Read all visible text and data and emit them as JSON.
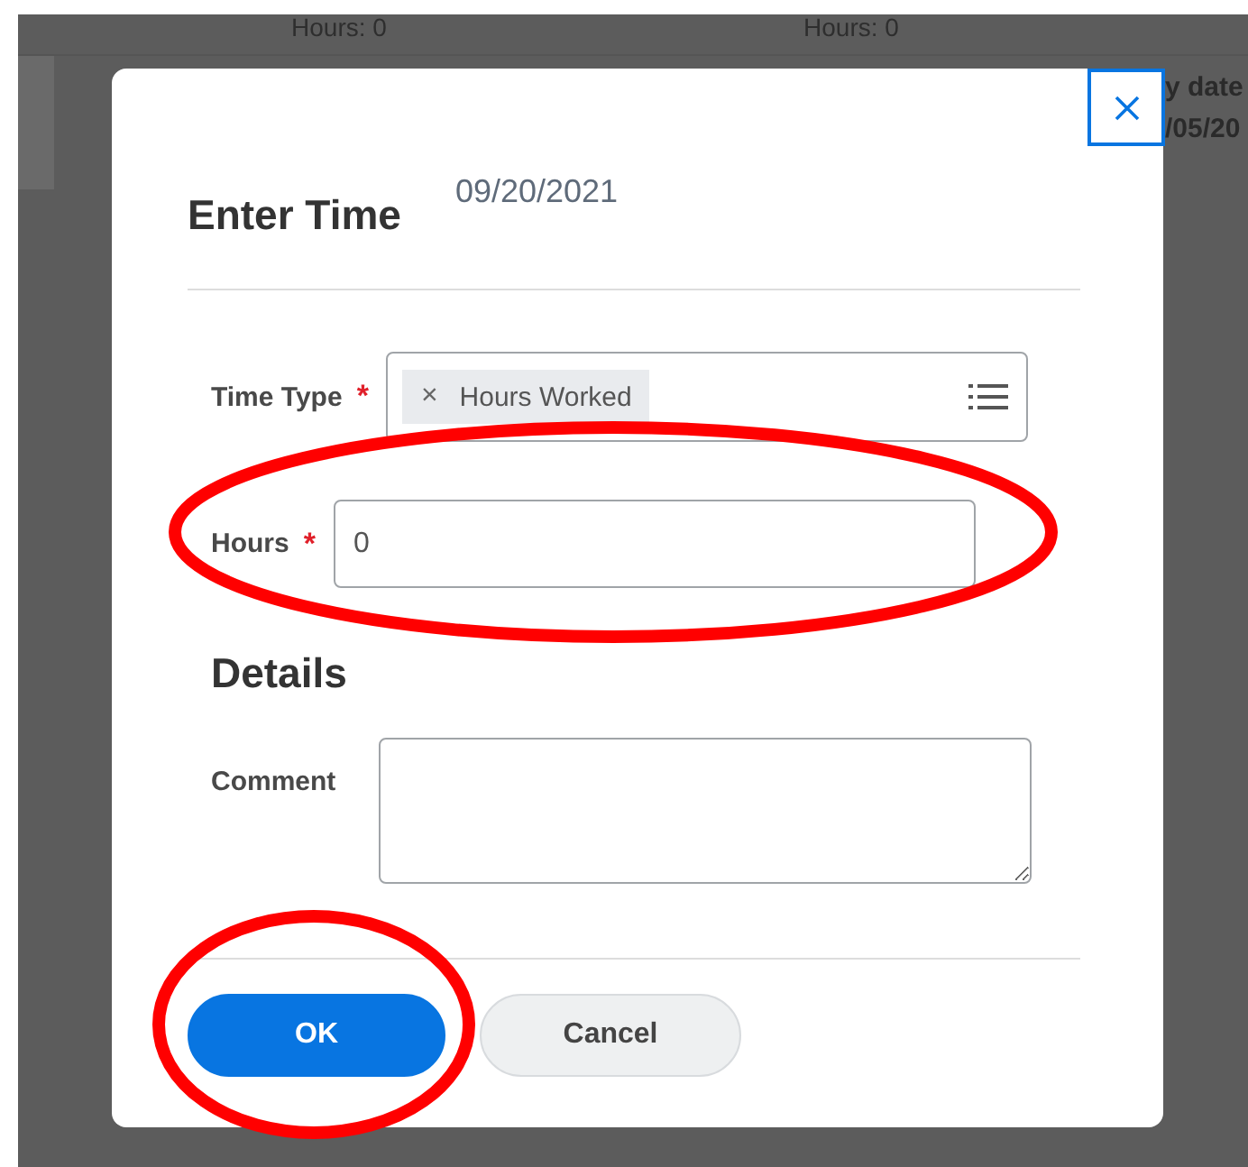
{
  "background": {
    "column_totals": [
      "Hours: 0",
      "Hours: 0"
    ],
    "side_text": [
      "y date",
      "/05/20"
    ]
  },
  "dialog": {
    "title": "Enter Time",
    "date": "09/20/2021",
    "fields": [
      {
        "kind": "multiselect",
        "label": "Time Type",
        "required_mark": "*",
        "tokens": [
          {
            "remove": "×",
            "text": "Hours Worked"
          }
        ]
      },
      {
        "kind": "text",
        "label": "Hours",
        "required_mark": "*",
        "value": "0"
      }
    ],
    "section": "Details",
    "comment": {
      "label": "Comment"
    },
    "buttons": [
      {
        "label": "OK",
        "primary": true
      },
      {
        "label": "Cancel",
        "primary": false
      }
    ]
  },
  "annotations": [
    {
      "kind": "ellipse"
    },
    {
      "kind": "ellipse"
    }
  ]
}
